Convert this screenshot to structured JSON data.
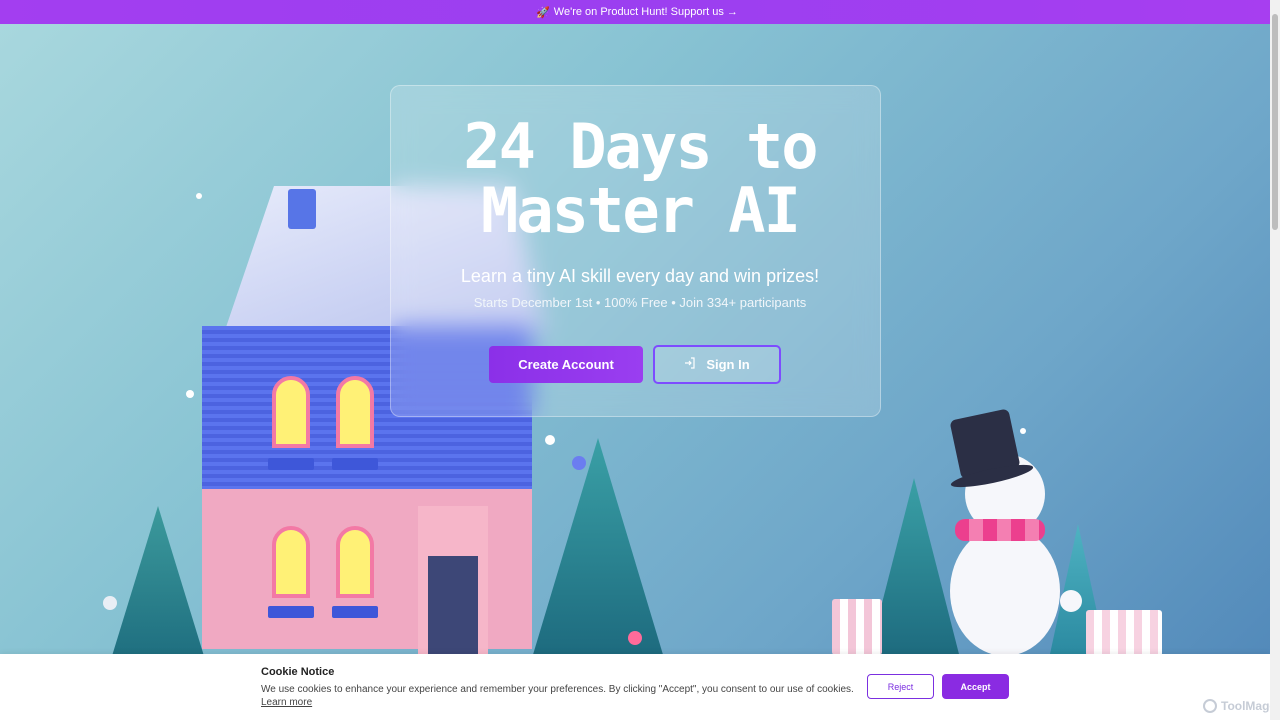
{
  "banner": {
    "rocket": "🚀",
    "text": "We're on Product Hunt! Support us →"
  },
  "hero": {
    "title_line1": "24 Days to",
    "title_line2": "Master AI",
    "subtitle": "Learn a tiny AI skill every day and win prizes!",
    "meta": "Starts December 1st • 100% Free • Join 334+ participants",
    "create_account_label": "Create Account",
    "sign_in_label": "Sign In",
    "sign_in_icon": "login-icon"
  },
  "cookie": {
    "title": "Cookie Notice",
    "text": "We use cookies to enhance your experience and remember your preferences. By clicking \"Accept\", you consent to our use of cookies.",
    "learn_more": "Learn more",
    "reject_label": "Reject",
    "accept_label": "Accept"
  },
  "watermark": {
    "text": "ToolMage"
  },
  "colors": {
    "accent": "#8a2be2",
    "banner": "#a33ef0"
  }
}
